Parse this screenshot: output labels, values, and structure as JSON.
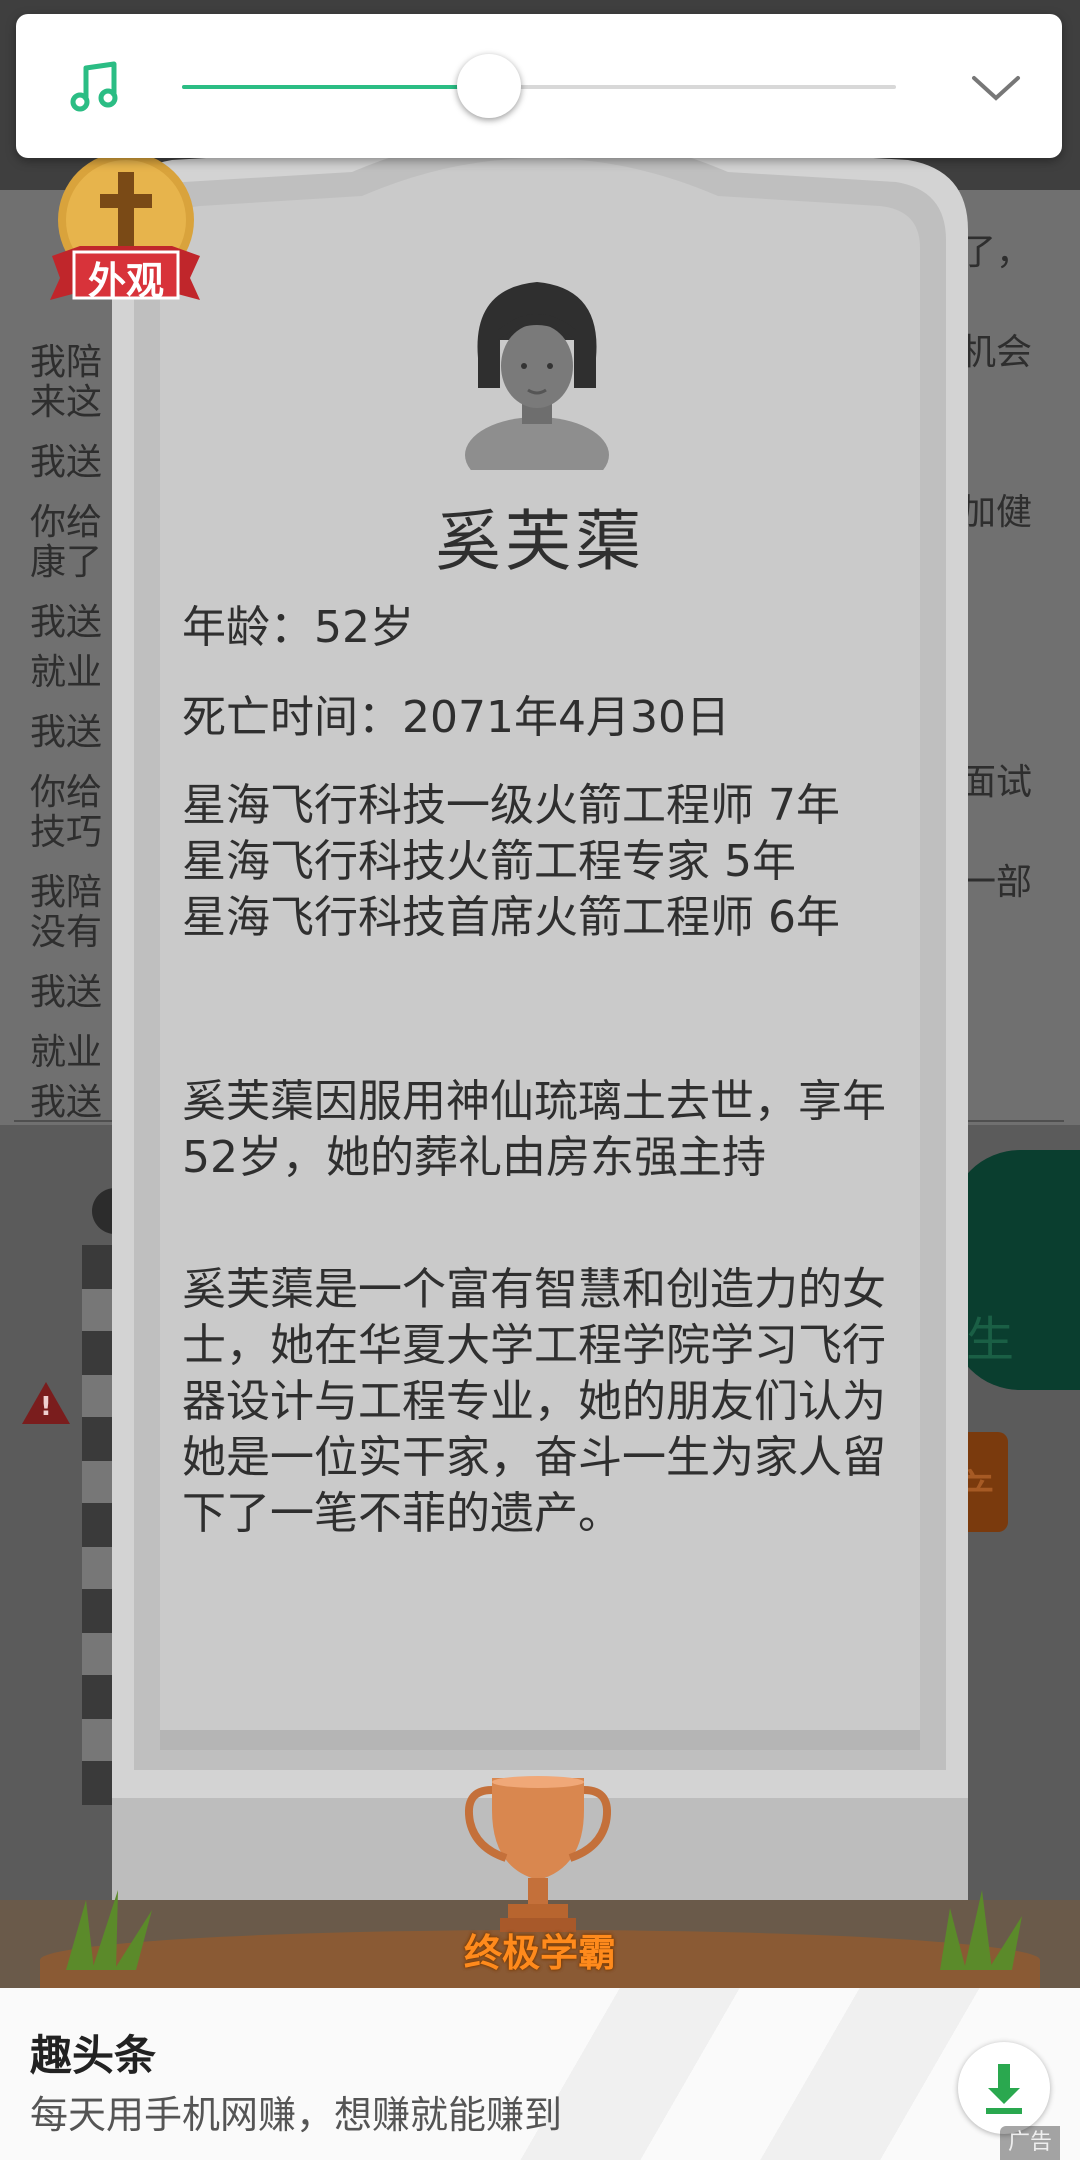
{
  "music_player": {
    "progress": 0.43,
    "icon": "music-note-icon",
    "collapse_icon": "chevron-down-icon"
  },
  "badge": {
    "label": "外观",
    "icon": "cross-icon"
  },
  "background_log": {
    "lines": [
      "我陪",
      "来这",
      "我送",
      "你给",
      "康了",
      "我送",
      "就业",
      "我送",
      "你给",
      "技巧",
      "我陪",
      "没有",
      "我送",
      "就业",
      "我送"
    ],
    "right_fragments": [
      "了，",
      "机会",
      "加健",
      "面试",
      "一部"
    ]
  },
  "tombstone": {
    "name": "奚芙蕖",
    "age": "年龄：52岁",
    "death_time": "死亡时间：2071年4月30日",
    "career": "星海飞行科技一级火箭工程师 7年\n星海飞行科技火箭工程专家 5年\n星海飞行科技首席火箭工程师 6年",
    "death_note": "奚芙蕖因服用神仙琉璃土去世，享年52岁，她的葬礼由房东强主持",
    "biography": "奚芙蕖是一个富有智慧和创造力的女士，她在华夏大学工程学院学习飞行器设计与工程专业，她的朋友们认为她是一位实干家，奋斗一生为家人留下了一笔不菲的遗产。",
    "achievement": "终极学霸"
  },
  "ad": {
    "title": "趣头条",
    "description": "每天用手机网赚，想赚就能赚到",
    "tag": "广告",
    "download_icon": "download-icon"
  },
  "colors": {
    "accent": "#2bbd84",
    "stone": "#c8c8c8",
    "trophy_text": "#ff8a1c"
  }
}
